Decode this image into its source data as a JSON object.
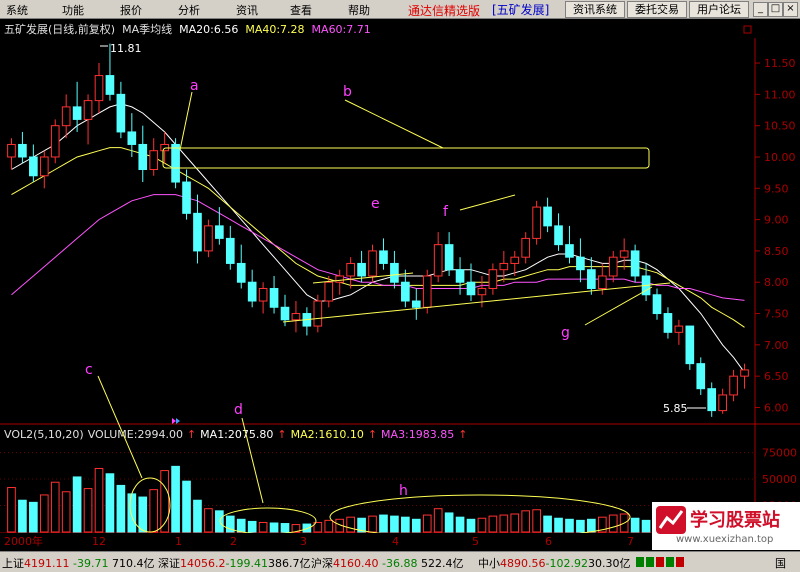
{
  "menu": {
    "items": [
      "系统",
      "功能",
      "报价",
      "分析",
      "资讯",
      "查看",
      "帮助"
    ],
    "app_title": "通达信精选版",
    "stock_tag": "[五矿发展]",
    "buttons": [
      "资讯系统",
      "委托交易",
      "用户论坛"
    ]
  },
  "legend": {
    "title": "五矿发展(日线,前复权)",
    "ma_label": "MA季均线",
    "ma20": "MA20:6.56",
    "ma40": "MA40:7.28",
    "ma60": "MA60:7.71"
  },
  "volume_legend": {
    "vol": "VOL2(5,10,20)",
    "volume": "VOLUME:2994.00",
    "ma1": "MA1:2075.80",
    "ma2": "MA2:1610.10",
    "ma3": "MA3:1983.85"
  },
  "price_axis": [
    "11.50",
    "11.00",
    "10.50",
    "10.00",
    "9.50",
    "9.00",
    "8.50",
    "8.00",
    "7.50",
    "7.00",
    "6.50",
    "6.00"
  ],
  "volume_axis": [
    "75000",
    "50000",
    "25000"
  ],
  "date_axis": [
    "2000年",
    "12",
    "1",
    "2",
    "3",
    "4",
    "5",
    "6",
    "7"
  ],
  "price_labels": {
    "high": "11.81",
    "low": "5.85"
  },
  "annotations": [
    "a",
    "b",
    "c",
    "d",
    "e",
    "f",
    "g",
    "h"
  ],
  "status": {
    "sh_label": "上证",
    "sh_value": "4191.11",
    "sh_change": "-39.71",
    "sh_amount": "710.4亿",
    "sz_label": "深证",
    "sz_value": "14056.2",
    "sz_change": "-199.41",
    "sz_amount": "386.7亿",
    "hs_label": "沪深",
    "hs_value": "4160.40",
    "hs_change": "-36.88",
    "hs_amount": "522.4亿",
    "zx_label": "中小",
    "zx_value": "4890.56",
    "zx_change": "-102.92",
    "zx_amount": "30.30亿"
  },
  "watermark": {
    "name": "学习股票站",
    "url": "www.xuexizhan.top"
  },
  "colors": {
    "up": "#ff3232",
    "down": "#54ffff",
    "ma20": "#ffffff",
    "ma40": "#ffff54",
    "ma60": "#ff54ff",
    "annotation": "#ffff00",
    "label": "#ff40ff"
  },
  "chart_data": {
    "type": "candlestick",
    "price_range": [
      5.8,
      11.9
    ],
    "candles": [
      [
        10.0,
        10.3,
        9.8,
        10.2
      ],
      [
        10.2,
        10.4,
        9.9,
        10.0
      ],
      [
        10.0,
        10.2,
        9.6,
        9.7
      ],
      [
        9.7,
        10.1,
        9.5,
        10.0
      ],
      [
        10.0,
        10.6,
        9.9,
        10.5
      ],
      [
        10.5,
        11.0,
        10.3,
        10.8
      ],
      [
        10.8,
        11.2,
        10.4,
        10.6
      ],
      [
        10.6,
        11.0,
        10.2,
        10.9
      ],
      [
        10.9,
        11.5,
        10.7,
        11.3
      ],
      [
        11.3,
        11.81,
        10.9,
        11.0
      ],
      [
        11.0,
        11.2,
        10.3,
        10.4
      ],
      [
        10.4,
        10.7,
        10.0,
        10.2
      ],
      [
        10.2,
        10.5,
        9.6,
        9.8
      ],
      [
        9.8,
        10.3,
        9.7,
        10.1
      ],
      [
        10.1,
        10.4,
        9.9,
        10.2
      ],
      [
        10.2,
        10.3,
        9.5,
        9.6
      ],
      [
        9.6,
        9.8,
        9.0,
        9.1
      ],
      [
        9.1,
        9.4,
        8.3,
        8.5
      ],
      [
        8.5,
        9.0,
        8.4,
        8.9
      ],
      [
        8.9,
        9.2,
        8.6,
        8.7
      ],
      [
        8.7,
        8.9,
        8.2,
        8.3
      ],
      [
        8.3,
        8.6,
        7.9,
        8.0
      ],
      [
        8.0,
        8.2,
        7.6,
        7.7
      ],
      [
        7.7,
        8.0,
        7.5,
        7.9
      ],
      [
        7.9,
        8.1,
        7.5,
        7.6
      ],
      [
        7.6,
        7.8,
        7.3,
        7.4
      ],
      [
        7.4,
        7.7,
        7.2,
        7.5
      ],
      [
        7.5,
        7.6,
        7.15,
        7.3
      ],
      [
        7.3,
        7.8,
        7.2,
        7.7
      ],
      [
        7.7,
        8.1,
        7.6,
        8.0
      ],
      [
        8.0,
        8.2,
        7.8,
        8.1
      ],
      [
        8.1,
        8.4,
        7.9,
        8.3
      ],
      [
        8.3,
        8.5,
        8.0,
        8.1
      ],
      [
        8.1,
        8.6,
        8.0,
        8.5
      ],
      [
        8.5,
        8.7,
        8.2,
        8.3
      ],
      [
        8.3,
        8.5,
        7.9,
        8.0
      ],
      [
        8.0,
        8.2,
        7.6,
        7.7
      ],
      [
        7.7,
        7.9,
        7.4,
        7.6
      ],
      [
        7.6,
        8.2,
        7.5,
        8.1
      ],
      [
        8.1,
        8.8,
        8.0,
        8.6
      ],
      [
        8.6,
        8.8,
        8.1,
        8.2
      ],
      [
        8.2,
        8.4,
        7.8,
        8.0
      ],
      [
        8.0,
        8.3,
        7.7,
        7.8
      ],
      [
        7.8,
        8.1,
        7.6,
        7.9
      ],
      [
        7.9,
        8.3,
        7.8,
        8.2
      ],
      [
        8.2,
        8.5,
        8.0,
        8.3
      ],
      [
        8.3,
        8.5,
        8.1,
        8.4
      ],
      [
        8.4,
        8.8,
        8.3,
        8.7
      ],
      [
        8.7,
        9.3,
        8.6,
        9.2
      ],
      [
        9.2,
        9.35,
        8.8,
        8.9
      ],
      [
        8.9,
        9.1,
        8.5,
        8.6
      ],
      [
        8.6,
        8.9,
        8.3,
        8.4
      ],
      [
        8.4,
        8.7,
        8.0,
        8.2
      ],
      [
        8.2,
        8.4,
        7.8,
        7.9
      ],
      [
        7.9,
        8.3,
        7.8,
        8.1
      ],
      [
        8.1,
        8.5,
        8.0,
        8.4
      ],
      [
        8.4,
        8.7,
        8.2,
        8.5
      ],
      [
        8.5,
        8.6,
        8.0,
        8.1
      ],
      [
        8.1,
        8.3,
        7.7,
        7.8
      ],
      [
        7.8,
        7.9,
        7.4,
        7.5
      ],
      [
        7.5,
        7.6,
        7.1,
        7.2
      ],
      [
        7.2,
        7.4,
        7.0,
        7.3
      ],
      [
        7.3,
        7.3,
        6.6,
        6.7
      ],
      [
        6.7,
        6.8,
        6.2,
        6.3
      ],
      [
        6.3,
        6.4,
        5.85,
        5.95
      ],
      [
        5.95,
        6.3,
        5.9,
        6.2
      ],
      [
        6.2,
        6.6,
        6.1,
        6.5
      ],
      [
        6.5,
        6.7,
        6.3,
        6.6
      ]
    ],
    "volume": [
      42000,
      30000,
      28000,
      35000,
      47000,
      38000,
      52000,
      41000,
      60000,
      55000,
      44000,
      36000,
      33000,
      40000,
      58000,
      62000,
      48000,
      30000,
      22000,
      20000,
      15000,
      12000,
      10000,
      9000,
      8500,
      8000,
      7000,
      7500,
      9000,
      11000,
      12000,
      14000,
      13000,
      15000,
      16000,
      15000,
      14000,
      12000,
      16000,
      22000,
      18000,
      14000,
      12000,
      13000,
      15000,
      16000,
      17000,
      20000,
      21000,
      15000,
      13000,
      12000,
      11000,
      12000,
      14000,
      16000,
      17000,
      13000,
      11000,
      10000,
      9000,
      8000,
      7000,
      6000,
      5000,
      4500,
      4000,
      4000
    ],
    "ma_series": [
      {
        "name": "MA20",
        "values": [
          9.8,
          9.9,
          10.0,
          10.1,
          10.2,
          10.35,
          10.5,
          10.6,
          10.7,
          10.8,
          10.85,
          10.8,
          10.7,
          10.55,
          10.4,
          10.2,
          10.0,
          9.8,
          9.6,
          9.4,
          9.2,
          9.0,
          8.8,
          8.6,
          8.4,
          8.2,
          8.0,
          7.8,
          7.7,
          7.7,
          7.75,
          7.8,
          7.9,
          8.0,
          8.05,
          8.1,
          8.1,
          8.1,
          8.1,
          8.15,
          8.2,
          8.2,
          8.2,
          8.15,
          8.1,
          8.1,
          8.15,
          8.2,
          8.3,
          8.4,
          8.45,
          8.45,
          8.4,
          8.35,
          8.3,
          8.3,
          8.35,
          8.35,
          8.3,
          8.2,
          8.05,
          7.9,
          7.7,
          7.5,
          7.25,
          7.0,
          6.8,
          6.56
        ]
      },
      {
        "name": "MA40",
        "values": [
          9.4,
          9.5,
          9.6,
          9.7,
          9.8,
          9.9,
          10.0,
          10.05,
          10.1,
          10.15,
          10.15,
          10.1,
          10.05,
          10.0,
          9.9,
          9.8,
          9.7,
          9.6,
          9.5,
          9.35,
          9.2,
          9.05,
          8.9,
          8.75,
          8.6,
          8.45,
          8.3,
          8.2,
          8.1,
          8.05,
          8.0,
          7.95,
          7.95,
          7.95,
          7.95,
          7.95,
          7.95,
          7.95,
          7.95,
          7.95,
          7.95,
          7.95,
          8.0,
          8.0,
          8.0,
          8.05,
          8.05,
          8.1,
          8.15,
          8.2,
          8.2,
          8.25,
          8.25,
          8.25,
          8.25,
          8.25,
          8.25,
          8.25,
          8.2,
          8.15,
          8.05,
          7.95,
          7.85,
          7.75,
          7.6,
          7.5,
          7.4,
          7.28
        ]
      },
      {
        "name": "MA60",
        "values": [
          7.8,
          7.95,
          8.1,
          8.25,
          8.4,
          8.55,
          8.7,
          8.85,
          9.0,
          9.1,
          9.2,
          9.3,
          9.35,
          9.4,
          9.4,
          9.4,
          9.35,
          9.3,
          9.2,
          9.1,
          9.0,
          8.9,
          8.8,
          8.7,
          8.6,
          8.5,
          8.4,
          8.3,
          8.2,
          8.15,
          8.1,
          8.05,
          8.0,
          8.0,
          7.95,
          7.95,
          7.95,
          7.9,
          7.9,
          7.9,
          7.9,
          7.9,
          7.9,
          7.95,
          7.95,
          7.95,
          8.0,
          8.0,
          8.0,
          8.05,
          8.05,
          8.05,
          8.05,
          8.05,
          8.05,
          8.05,
          8.05,
          8.0,
          8.0,
          7.95,
          7.95,
          7.9,
          7.9,
          7.85,
          7.8,
          7.75,
          7.73,
          7.71
        ]
      }
    ]
  }
}
